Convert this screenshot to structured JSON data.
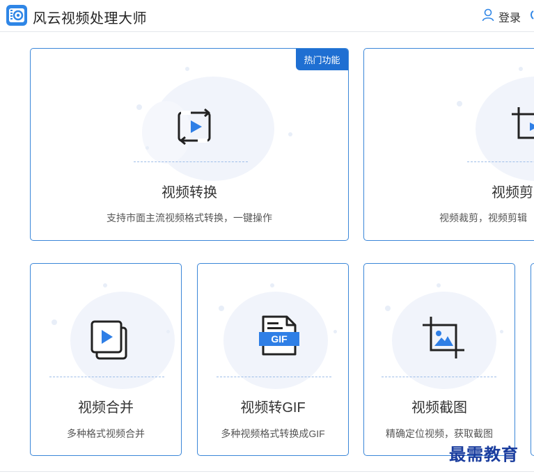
{
  "header": {
    "app_title": "风云视频处理大师",
    "login_label": "登录"
  },
  "cards": [
    {
      "title": "视频转换",
      "desc": "支持市面主流视频格式转换，一键操作",
      "badge": "热门功能",
      "icon": "video-convert-icon"
    },
    {
      "title": "视频剪",
      "desc": "视频裁剪，视频剪辑",
      "icon": "video-crop-icon"
    },
    {
      "title": "视频合并",
      "desc": "多种格式视频合并",
      "icon": "video-merge-icon"
    },
    {
      "title": "视频转GIF",
      "desc": "多种视频格式转换成GIF",
      "icon": "gif-file-icon",
      "icon_text": "GIF"
    },
    {
      "title": "视频截图",
      "desc": "精确定位视频，获取截图",
      "icon": "screenshot-crop-icon"
    }
  ],
  "watermark": "最需教育",
  "colors": {
    "accent": "#2f86e6",
    "card_border": "#3a86d8",
    "badge_bg": "#1f6fd2",
    "play_blue": "#2f7fe6"
  }
}
